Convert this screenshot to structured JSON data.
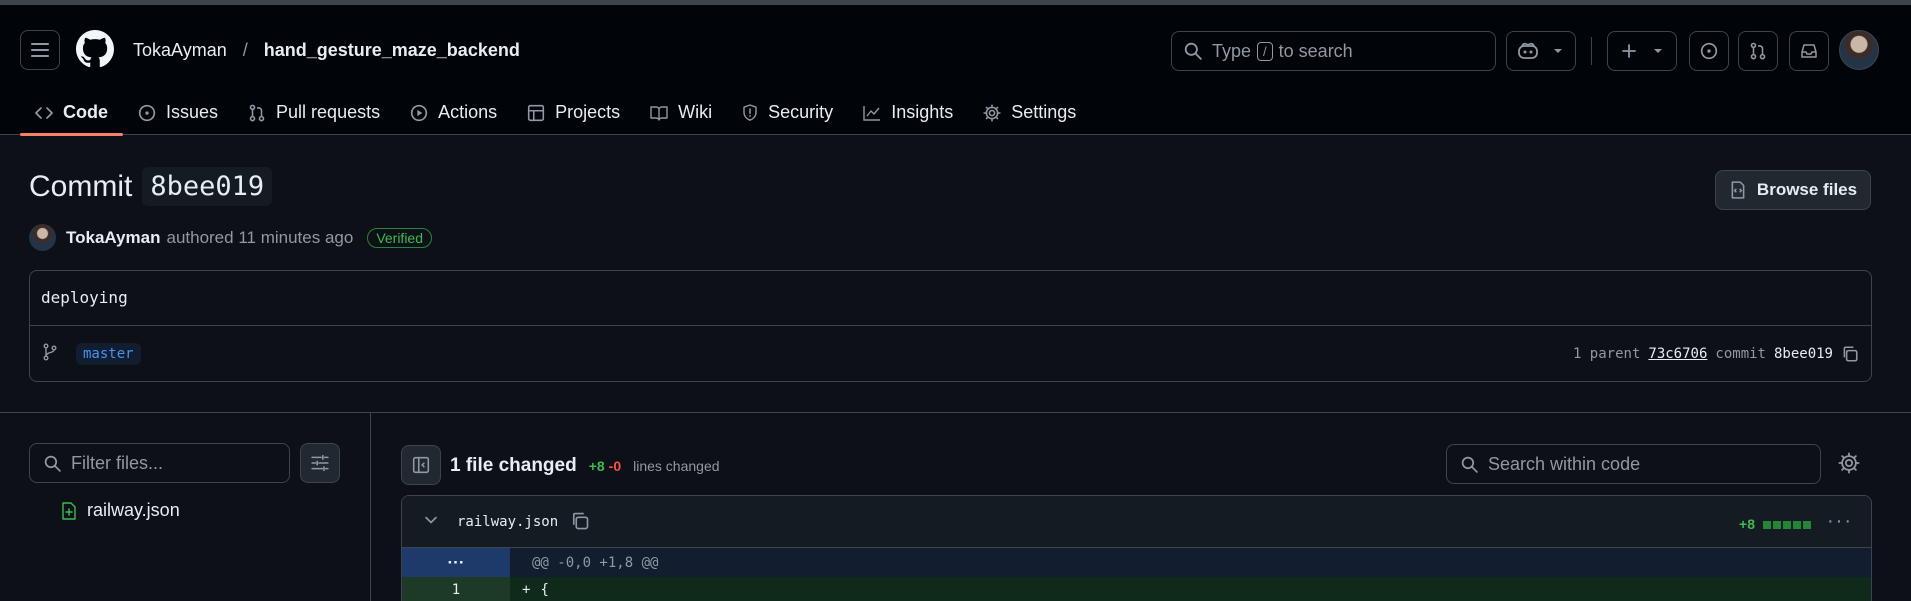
{
  "header": {
    "owner": "TokaAyman",
    "separator": "/",
    "repo": "hand_gesture_maze_backend",
    "search": {
      "prefix": "Type",
      "key": "/",
      "suffix": "to search"
    }
  },
  "tabs": [
    {
      "label": "Code",
      "icon": "code-icon"
    },
    {
      "label": "Issues",
      "icon": "issue-icon"
    },
    {
      "label": "Pull requests",
      "icon": "pull-request-icon"
    },
    {
      "label": "Actions",
      "icon": "play-icon"
    },
    {
      "label": "Projects",
      "icon": "table-icon"
    },
    {
      "label": "Wiki",
      "icon": "book-icon"
    },
    {
      "label": "Security",
      "icon": "shield-icon"
    },
    {
      "label": "Insights",
      "icon": "graph-icon"
    },
    {
      "label": "Settings",
      "icon": "gear-icon"
    }
  ],
  "commit": {
    "title_word": "Commit",
    "sha": "8bee019",
    "browse_label": "Browse files",
    "author": "TokaAyman",
    "authored_text": "authored 11 minutes ago",
    "verified_label": "Verified",
    "message": "deploying",
    "branch": "master",
    "parent_text": "1 parent",
    "parent_sha": "73c6706",
    "commit_label": "commit",
    "commit_sha": "8bee019"
  },
  "sidebar": {
    "filter_placeholder": "Filter files...",
    "files": [
      "railway.json"
    ]
  },
  "diff": {
    "files_changed": "1 file changed",
    "additions": "+8",
    "deletions": "-0",
    "lines_changed": "lines changed",
    "search_placeholder": "Search within code",
    "file": {
      "name": "railway.json",
      "additions": "+8",
      "hunk_expander": "···",
      "hunk_header": "@@ -0,0 +1,8 @@",
      "lines": [
        {
          "number": "1",
          "sign": "+",
          "code": "{"
        }
      ]
    }
  },
  "colors": {
    "accent_tab": "#f78166",
    "add": "#3fb950",
    "del": "#f85149",
    "link": "#4493f8"
  }
}
